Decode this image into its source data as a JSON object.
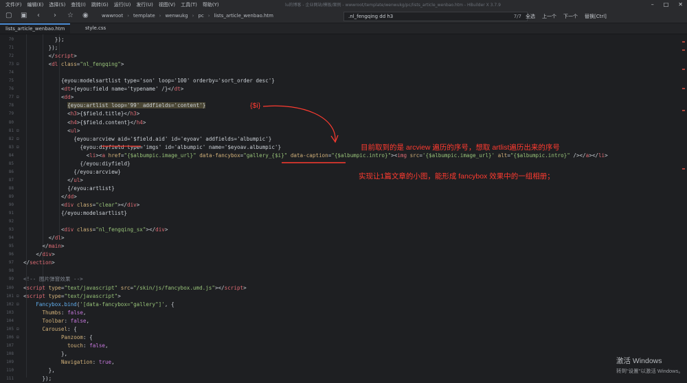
{
  "menu": [
    "文件(F)",
    "编辑(E)",
    "选择(S)",
    "查找(I)",
    "跳转(G)",
    "运行(U)",
    "发行(U)",
    "视图(V)",
    "工具(T)",
    "帮助(Y)"
  ],
  "window_path": "lu的博客 - 企业网站/模板/案例 - wwwroot/template/wenwukg/pc/lists_article_wenbao.htm - HBuilder X 3.7.9",
  "window_controls": [
    "–",
    "□",
    "✕"
  ],
  "breadcrumbs": [
    "wwwroot",
    "template",
    "wenwukg",
    "pc",
    "lists_article_wenbao.htm"
  ],
  "find": {
    "query": ".nl_fengqing dd h3",
    "count": "7/7",
    "all": "全选",
    "prev": "上一个",
    "next": "下一个",
    "replace": "替换[Ctrl]"
  },
  "tabs": [
    {
      "label": "lists_article_wenbao.htm",
      "active": true
    },
    {
      "label": "style.css",
      "active": false
    }
  ],
  "lines": [
    {
      "n": "70",
      "fold": "",
      "indent": 10,
      "segments": [
        {
          "t": "});",
          "c": ""
        }
      ]
    },
    {
      "n": "71",
      "fold": "",
      "indent": 8,
      "segments": [
        {
          "t": "});",
          "c": ""
        }
      ]
    },
    {
      "n": "72",
      "fold": "",
      "indent": 8,
      "segments": [
        {
          "t": "</",
          "c": ""
        },
        {
          "t": "script",
          "c": "tag"
        },
        {
          "t": ">",
          "c": ""
        }
      ]
    },
    {
      "n": "73",
      "fold": "⊟",
      "indent": 8,
      "segments": [
        {
          "t": "<",
          "c": ""
        },
        {
          "t": "dl",
          "c": "tag"
        },
        {
          "t": " class",
          "c": "attr"
        },
        {
          "t": "=",
          "c": ""
        },
        {
          "t": "\"nl_fengqing\"",
          "c": "str"
        },
        {
          "t": ">",
          "c": ""
        }
      ]
    },
    {
      "n": "74",
      "fold": "",
      "indent": 0,
      "segments": []
    },
    {
      "n": "75",
      "fold": "",
      "indent": 12,
      "segments": [
        {
          "t": "{eyou:modelsartlist type='son' loop='100' orderby='sort_order desc'}",
          "c": ""
        }
      ]
    },
    {
      "n": "76",
      "fold": "",
      "indent": 12,
      "segments": [
        {
          "t": "<",
          "c": ""
        },
        {
          "t": "dt",
          "c": "tag"
        },
        {
          "t": ">{eyou:field name='typename' /}</",
          "c": ""
        },
        {
          "t": "dt",
          "c": "tag"
        },
        {
          "t": ">",
          "c": ""
        }
      ]
    },
    {
      "n": "77",
      "fold": "⊟",
      "indent": 12,
      "segments": [
        {
          "t": "<",
          "c": ""
        },
        {
          "t": "dd",
          "c": "tag"
        },
        {
          "t": ">",
          "c": ""
        }
      ]
    },
    {
      "n": "78",
      "fold": "",
      "indent": 14,
      "segments": [
        {
          "t": "{eyou:artlist loop='99' addfields='content'}",
          "c": "hl"
        }
      ]
    },
    {
      "n": "79",
      "fold": "",
      "indent": 14,
      "segments": [
        {
          "t": "<",
          "c": ""
        },
        {
          "t": "h3",
          "c": "tag"
        },
        {
          "t": ">{$field.title}</",
          "c": ""
        },
        {
          "t": "h3",
          "c": "tag"
        },
        {
          "t": ">",
          "c": ""
        }
      ]
    },
    {
      "n": "80",
      "fold": "",
      "indent": 14,
      "segments": [
        {
          "t": "<",
          "c": ""
        },
        {
          "t": "h4",
          "c": "tag"
        },
        {
          "t": ">{$field.content}</",
          "c": ""
        },
        {
          "t": "h4",
          "c": "tag"
        },
        {
          "t": ">",
          "c": ""
        }
      ]
    },
    {
      "n": "81",
      "fold": "⊟",
      "indent": 14,
      "segments": [
        {
          "t": "<",
          "c": ""
        },
        {
          "t": "ul",
          "c": "tag"
        },
        {
          "t": ">",
          "c": ""
        }
      ]
    },
    {
      "n": "82",
      "fold": "⊟",
      "indent": 16,
      "segments": [
        {
          "t": "{eyou:arcview aid='$field.aid' id='eyoav' addfields='albumpic'}",
          "c": ""
        }
      ]
    },
    {
      "n": "83",
      "fold": "⊟",
      "indent": 18,
      "segments": [
        {
          "t": "{eyou:diyfield type='imgs' id='albumpic' name='$eyoav.albumpic'}",
          "c": ""
        }
      ]
    },
    {
      "n": "84",
      "fold": "",
      "indent": 20,
      "segments": [
        {
          "t": "<",
          "c": ""
        },
        {
          "t": "li",
          "c": "tag"
        },
        {
          "t": "><",
          "c": ""
        },
        {
          "t": "a",
          "c": "tag"
        },
        {
          "t": " href",
          "c": "attr"
        },
        {
          "t": "=",
          "c": ""
        },
        {
          "t": "\"{$albumpic.image_url}\"",
          "c": "str"
        },
        {
          "t": " data-fancybox",
          "c": "attr"
        },
        {
          "t": "=",
          "c": ""
        },
        {
          "t": "\"gallery_{$i}\"",
          "c": "str"
        },
        {
          "t": " data-caption",
          "c": "attr"
        },
        {
          "t": "=",
          "c": ""
        },
        {
          "t": "\"{$albumpic.intro}\"",
          "c": "str"
        },
        {
          "t": "><",
          "c": ""
        },
        {
          "t": "img",
          "c": "tag"
        },
        {
          "t": " src",
          "c": "attr"
        },
        {
          "t": "=",
          "c": ""
        },
        {
          "t": "'{$albumpic.image_url}'",
          "c": "str"
        },
        {
          "t": " alt",
          "c": "attr"
        },
        {
          "t": "=",
          "c": ""
        },
        {
          "t": "\"{$albumpic.intro}\"",
          "c": "str"
        },
        {
          "t": " /></",
          "c": ""
        },
        {
          "t": "a",
          "c": "tag"
        },
        {
          "t": "></",
          "c": ""
        },
        {
          "t": "li",
          "c": "tag"
        },
        {
          "t": ">",
          "c": ""
        }
      ]
    },
    {
      "n": "85",
      "fold": "",
      "indent": 18,
      "segments": [
        {
          "t": "{/eyou:diyfield}",
          "c": ""
        }
      ]
    },
    {
      "n": "86",
      "fold": "",
      "indent": 16,
      "segments": [
        {
          "t": "{/eyou:arcview}",
          "c": ""
        }
      ]
    },
    {
      "n": "87",
      "fold": "",
      "indent": 14,
      "segments": [
        {
          "t": "</",
          "c": ""
        },
        {
          "t": "ul",
          "c": "tag"
        },
        {
          "t": ">",
          "c": ""
        }
      ]
    },
    {
      "n": "88",
      "fold": "",
      "indent": 14,
      "segments": [
        {
          "t": "{/eyou:artlist}",
          "c": ""
        }
      ]
    },
    {
      "n": "89",
      "fold": "",
      "indent": 12,
      "segments": [
        {
          "t": "</",
          "c": ""
        },
        {
          "t": "dd",
          "c": "tag"
        },
        {
          "t": ">",
          "c": ""
        }
      ]
    },
    {
      "n": "90",
      "fold": "",
      "indent": 12,
      "segments": [
        {
          "t": "<",
          "c": ""
        },
        {
          "t": "div",
          "c": "tag"
        },
        {
          "t": " class",
          "c": "attr"
        },
        {
          "t": "=",
          "c": ""
        },
        {
          "t": "\"clear\"",
          "c": "str"
        },
        {
          "t": "></",
          "c": ""
        },
        {
          "t": "div",
          "c": "tag"
        },
        {
          "t": ">",
          "c": ""
        }
      ]
    },
    {
      "n": "91",
      "fold": "",
      "indent": 12,
      "segments": [
        {
          "t": "{/eyou:modelsartlist}",
          "c": ""
        }
      ]
    },
    {
      "n": "92",
      "fold": "",
      "indent": 0,
      "segments": []
    },
    {
      "n": "93",
      "fold": "",
      "indent": 12,
      "segments": [
        {
          "t": "<",
          "c": ""
        },
        {
          "t": "div",
          "c": "tag"
        },
        {
          "t": " class",
          "c": "attr"
        },
        {
          "t": "=",
          "c": ""
        },
        {
          "t": "\"nl_fengqing_sx\"",
          "c": "str"
        },
        {
          "t": "></",
          "c": ""
        },
        {
          "t": "div",
          "c": "tag"
        },
        {
          "t": ">",
          "c": ""
        }
      ]
    },
    {
      "n": "94",
      "fold": "",
      "indent": 8,
      "segments": [
        {
          "t": "</",
          "c": ""
        },
        {
          "t": "dl",
          "c": "tag"
        },
        {
          "t": ">",
          "c": ""
        }
      ]
    },
    {
      "n": "95",
      "fold": "",
      "indent": 6,
      "segments": [
        {
          "t": "</",
          "c": ""
        },
        {
          "t": "main",
          "c": "tag"
        },
        {
          "t": ">",
          "c": ""
        }
      ]
    },
    {
      "n": "96",
      "fold": "",
      "indent": 4,
      "segments": [
        {
          "t": "</",
          "c": ""
        },
        {
          "t": "div",
          "c": "tag"
        },
        {
          "t": ">",
          "c": ""
        }
      ]
    },
    {
      "n": "97",
      "fold": "",
      "indent": 0,
      "segments": [
        {
          "t": "</",
          "c": ""
        },
        {
          "t": "section",
          "c": "tag"
        },
        {
          "t": ">",
          "c": ""
        }
      ]
    },
    {
      "n": "98",
      "fold": "",
      "indent": 0,
      "segments": []
    },
    {
      "n": "99",
      "fold": "",
      "indent": 0,
      "segments": [
        {
          "t": "<!-- 图片弹窗效果 -->",
          "c": "cm"
        }
      ]
    },
    {
      "n": "100",
      "fold": "",
      "indent": 0,
      "segments": [
        {
          "t": "<",
          "c": ""
        },
        {
          "t": "script",
          "c": "tag"
        },
        {
          "t": " type",
          "c": "attr"
        },
        {
          "t": "=",
          "c": ""
        },
        {
          "t": "\"text/javascript\"",
          "c": "str"
        },
        {
          "t": " src",
          "c": "attr"
        },
        {
          "t": "=",
          "c": ""
        },
        {
          "t": "\"/skin/js/fancybox.umd.js\"",
          "c": "str"
        },
        {
          "t": "></",
          "c": ""
        },
        {
          "t": "script",
          "c": "tag"
        },
        {
          "t": ">",
          "c": ""
        }
      ]
    },
    {
      "n": "101",
      "fold": "⊟",
      "indent": 0,
      "segments": [
        {
          "t": "<",
          "c": ""
        },
        {
          "t": "script",
          "c": "tag"
        },
        {
          "t": " type",
          "c": "attr"
        },
        {
          "t": "=",
          "c": ""
        },
        {
          "t": "\"text/javascript\"",
          "c": "str"
        },
        {
          "t": ">",
          "c": ""
        }
      ]
    },
    {
      "n": "102",
      "fold": "⊟",
      "indent": 4,
      "segments": [
        {
          "t": "Fancybox",
          "c": "fn"
        },
        {
          "t": ".",
          "c": ""
        },
        {
          "t": "bind",
          "c": "fn"
        },
        {
          "t": "(",
          "c": ""
        },
        {
          "t": "'[data-fancybox=\"gallery\"]'",
          "c": "str"
        },
        {
          "t": ", {",
          "c": ""
        }
      ]
    },
    {
      "n": "103",
      "fold": "",
      "indent": 6,
      "segments": [
        {
          "t": "Thumbs",
          "c": "attr"
        },
        {
          "t": ": ",
          "c": ""
        },
        {
          "t": "false",
          "c": "kw"
        },
        {
          "t": ",",
          "c": ""
        }
      ]
    },
    {
      "n": "104",
      "fold": "",
      "indent": 6,
      "segments": [
        {
          "t": "Toolbar",
          "c": "attr"
        },
        {
          "t": ": ",
          "c": ""
        },
        {
          "t": "false",
          "c": "kw"
        },
        {
          "t": ",",
          "c": ""
        }
      ]
    },
    {
      "n": "105",
      "fold": "⊟",
      "indent": 6,
      "segments": [
        {
          "t": "Carousel",
          "c": "attr"
        },
        {
          "t": ": {",
          "c": ""
        }
      ]
    },
    {
      "n": "106",
      "fold": "⊟",
      "indent": 12,
      "segments": [
        {
          "t": "Panzoom",
          "c": "attr"
        },
        {
          "t": ": {",
          "c": ""
        }
      ]
    },
    {
      "n": "107",
      "fold": "",
      "indent": 14,
      "segments": [
        {
          "t": "touch",
          "c": "attr"
        },
        {
          "t": ": ",
          "c": ""
        },
        {
          "t": "false",
          "c": "kw"
        },
        {
          "t": ",",
          "c": ""
        }
      ]
    },
    {
      "n": "108",
      "fold": "",
      "indent": 12,
      "segments": [
        {
          "t": "},",
          "c": ""
        }
      ]
    },
    {
      "n": "109",
      "fold": "",
      "indent": 12,
      "segments": [
        {
          "t": "Navigation",
          "c": "attr"
        },
        {
          "t": ": ",
          "c": ""
        },
        {
          "t": "true",
          "c": "kw"
        },
        {
          "t": ",",
          "c": ""
        }
      ]
    },
    {
      "n": "110",
      "fold": "",
      "indent": 8,
      "segments": [
        {
          "t": "},",
          "c": ""
        }
      ]
    },
    {
      "n": "111",
      "fold": "",
      "indent": 6,
      "segments": [
        {
          "t": "});",
          "c": ""
        }
      ]
    }
  ],
  "annotations": {
    "label_i": "{$i}",
    "note1": "目前取到的是 arcview 遍历的序号，想取  artlist遍历出来的序号",
    "note2": "实现让1篇文章的小图，能形成 fancybox 效果中的一组相册；"
  },
  "watermark": {
    "line1": "激活 Windows",
    "line2": "转到\"设置\"以激活 Windows。"
  },
  "colors": {
    "background": "#1e1f22",
    "annotation": "#ff3b30",
    "tag": "#e06c75",
    "string": "#98c379"
  }
}
